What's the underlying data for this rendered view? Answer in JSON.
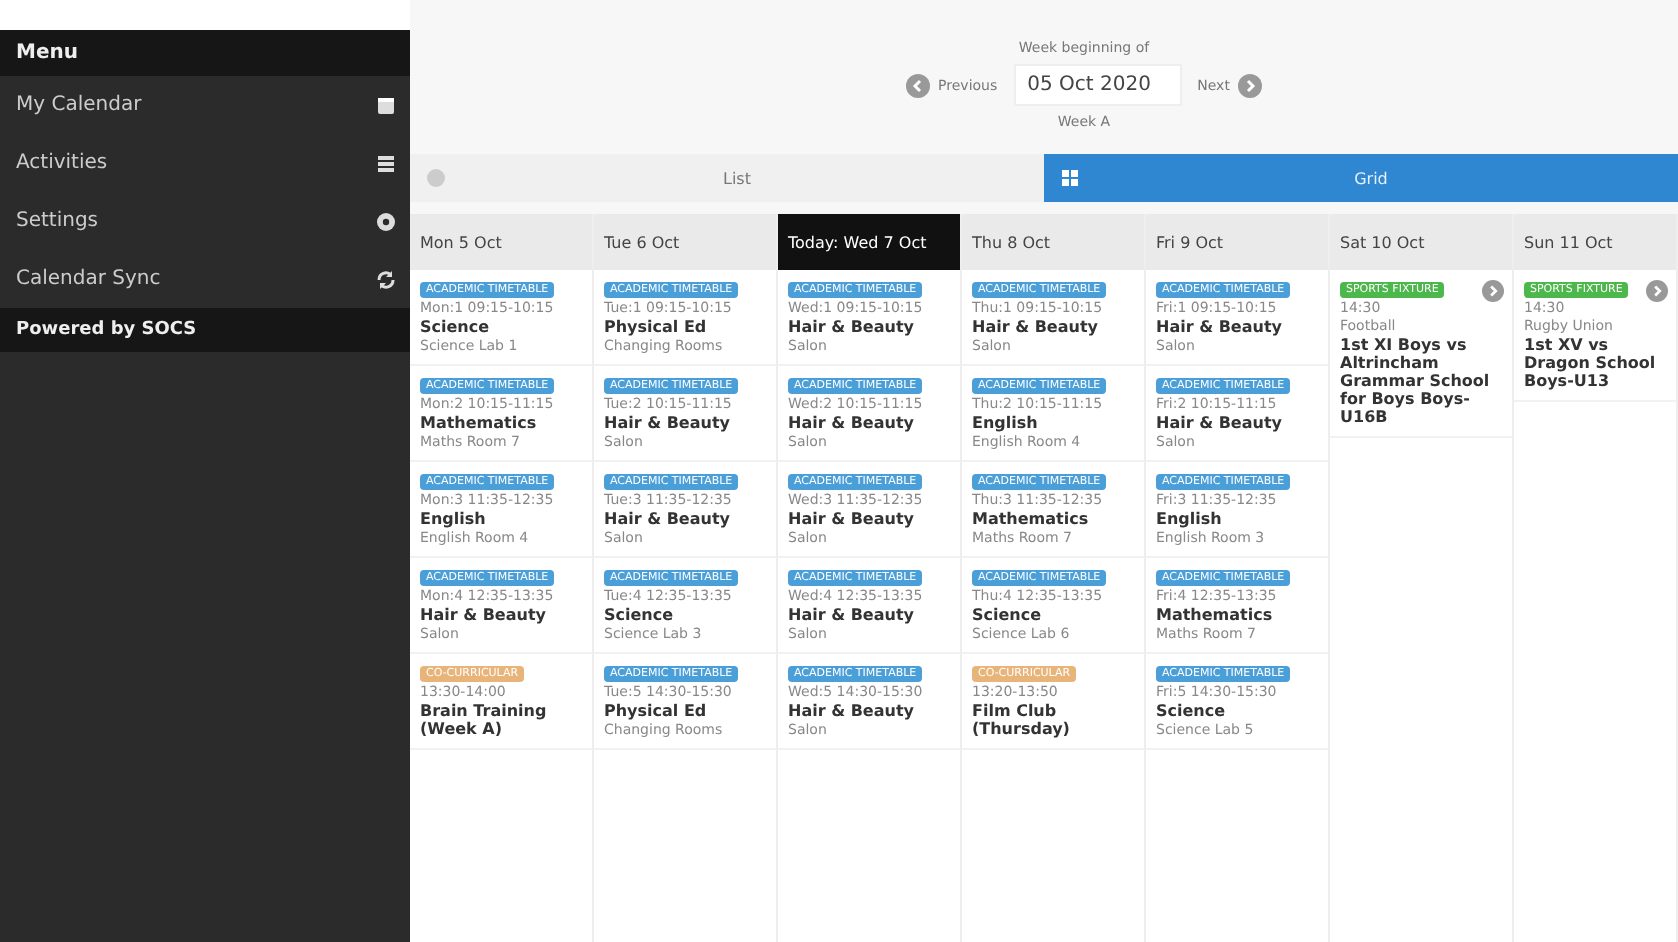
{
  "sidebar": {
    "title": "Menu",
    "items": [
      {
        "label": "My Calendar"
      },
      {
        "label": "Activities"
      },
      {
        "label": "Settings"
      },
      {
        "label": "Calendar Sync"
      }
    ],
    "footer": "Powered by SOCS"
  },
  "week_picker": {
    "label": "Week beginning of",
    "previous": "Previous",
    "date": "05 Oct 2020",
    "next": "Next",
    "note": "Week A"
  },
  "view_toggle": [
    {
      "label": "List",
      "selected": false
    },
    {
      "label": "Grid",
      "selected": true
    }
  ],
  "days": [
    {
      "label": "Mon 5 Oct",
      "selected": false,
      "events": [
        {
          "kind": "lesson",
          "tag": "ACADEMIC TIMETABLE",
          "time": "Mon:1 09:15-10:15",
          "title": "Science",
          "place": "Science Lab 1"
        },
        {
          "kind": "lesson",
          "tag": "ACADEMIC TIMETABLE",
          "time": "Mon:2 10:15-11:15",
          "title": "Mathematics",
          "place": "Maths Room 7"
        },
        {
          "kind": "lesson",
          "tag": "ACADEMIC TIMETABLE",
          "time": "Mon:3 11:35-12:35",
          "title": "English",
          "place": "English Room 4"
        },
        {
          "kind": "lesson",
          "tag": "ACADEMIC TIMETABLE",
          "time": "Mon:4 12:35-13:35",
          "title": "Hair & Beauty",
          "place": "Salon"
        },
        {
          "kind": "activity",
          "tag": "CO-CURRICULAR",
          "time": "13:30-14:00",
          "title": "Brain Training (Week A)"
        }
      ]
    },
    {
      "label": "Tue 6 Oct",
      "selected": false,
      "events": [
        {
          "kind": "lesson",
          "tag": "ACADEMIC TIMETABLE",
          "time": "Tue:1 09:15-10:15",
          "title": "Physical Ed",
          "place": "Changing Rooms"
        },
        {
          "kind": "lesson",
          "tag": "ACADEMIC TIMETABLE",
          "time": "Tue:2 10:15-11:15",
          "title": "Hair & Beauty",
          "place": "Salon"
        },
        {
          "kind": "lesson",
          "tag": "ACADEMIC TIMETABLE",
          "time": "Tue:3 11:35-12:35",
          "title": "Hair & Beauty",
          "place": "Salon"
        },
        {
          "kind": "lesson",
          "tag": "ACADEMIC TIMETABLE",
          "time": "Tue:4 12:35-13:35",
          "title": "Science",
          "place": "Science Lab 3"
        },
        {
          "kind": "lesson",
          "tag": "ACADEMIC TIMETABLE",
          "time": "Tue:5 14:30-15:30",
          "title": "Physical Ed",
          "place": "Changing Rooms"
        }
      ]
    },
    {
      "label": "Today: Wed 7 Oct",
      "selected": true,
      "events": [
        {
          "kind": "lesson",
          "tag": "ACADEMIC TIMETABLE",
          "time": "Wed:1 09:15-10:15",
          "title": "Hair & Beauty",
          "place": "Salon"
        },
        {
          "kind": "lesson",
          "tag": "ACADEMIC TIMETABLE",
          "time": "Wed:2 10:15-11:15",
          "title": "Hair & Beauty",
          "place": "Salon"
        },
        {
          "kind": "lesson",
          "tag": "ACADEMIC TIMETABLE",
          "time": "Wed:3 11:35-12:35",
          "title": "Hair & Beauty",
          "place": "Salon"
        },
        {
          "kind": "lesson",
          "tag": "ACADEMIC TIMETABLE",
          "time": "Wed:4 12:35-13:35",
          "title": "Hair & Beauty",
          "place": "Salon"
        },
        {
          "kind": "lesson",
          "tag": "ACADEMIC TIMETABLE",
          "time": "Wed:5 14:30-15:30",
          "title": "Hair & Beauty",
          "place": "Salon"
        }
      ]
    },
    {
      "label": "Thu 8 Oct",
      "selected": false,
      "events": [
        {
          "kind": "lesson",
          "tag": "ACADEMIC TIMETABLE",
          "time": "Thu:1 09:15-10:15",
          "title": "Hair & Beauty",
          "place": "Salon"
        },
        {
          "kind": "lesson",
          "tag": "ACADEMIC TIMETABLE",
          "time": "Thu:2 10:15-11:15",
          "title": "English",
          "place": "English Room 4"
        },
        {
          "kind": "lesson",
          "tag": "ACADEMIC TIMETABLE",
          "time": "Thu:3 11:35-12:35",
          "title": "Mathematics",
          "place": "Maths Room 7"
        },
        {
          "kind": "lesson",
          "tag": "ACADEMIC TIMETABLE",
          "time": "Thu:4 12:35-13:35",
          "title": "Science",
          "place": "Science Lab 6"
        },
        {
          "kind": "activity",
          "tag": "CO-CURRICULAR",
          "time": "13:20-13:50",
          "title": "Film Club (Thursday)"
        }
      ]
    },
    {
      "label": "Fri 9 Oct",
      "selected": false,
      "events": [
        {
          "kind": "lesson",
          "tag": "ACADEMIC TIMETABLE",
          "time": "Fri:1 09:15-10:15",
          "title": "Hair & Beauty",
          "place": "Salon"
        },
        {
          "kind": "lesson",
          "tag": "ACADEMIC TIMETABLE",
          "time": "Fri:2 10:15-11:15",
          "title": "Hair & Beauty",
          "place": "Salon"
        },
        {
          "kind": "lesson",
          "tag": "ACADEMIC TIMETABLE",
          "time": "Fri:3 11:35-12:35",
          "title": "English",
          "place": "English Room 3"
        },
        {
          "kind": "lesson",
          "tag": "ACADEMIC TIMETABLE",
          "time": "Fri:4 12:35-13:35",
          "title": "Mathematics",
          "place": "Maths Room 7"
        },
        {
          "kind": "lesson",
          "tag": "ACADEMIC TIMETABLE",
          "time": "Fri:5 14:30-15:30",
          "title": "Science",
          "place": "Science Lab 5"
        }
      ]
    },
    {
      "label": "Sat 10 Oct",
      "selected": false,
      "events": [
        {
          "kind": "fixture",
          "tag": "SPORTS FIXTURE",
          "time": "14:30",
          "sport": "Football",
          "title": "1st XI Boys vs Altrincham Grammar School for Boys Boys-U16B"
        }
      ]
    },
    {
      "label": "Sun 11 Oct",
      "selected": false,
      "events": [
        {
          "kind": "fixture",
          "tag": "SPORTS FIXTURE",
          "time": "14:30",
          "sport": "Rugby Union",
          "title": "1st XV vs Dragon School Boys-U13"
        }
      ]
    }
  ]
}
